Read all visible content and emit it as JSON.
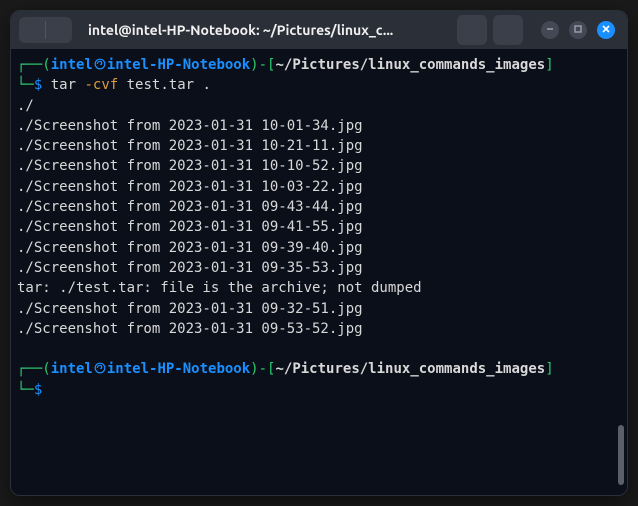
{
  "titlebar": {
    "title": "intel@intel-HP-Notebook: ~/Pictures/linux_c..."
  },
  "prompt": {
    "open_br": "┌──(",
    "user": "intel",
    "at": "㉿",
    "host": "intel-HP-Notebook",
    "close_br": ")-[",
    "path": "~/Pictures/linux_commands_images",
    "end_br": "]",
    "line2_pre": "└─",
    "dollar": "$"
  },
  "command": {
    "bin": "tar",
    "flag": "-cvf",
    "args": "test.tar ."
  },
  "output": [
    "./",
    "./Screenshot from 2023-01-31 10-01-34.jpg",
    "./Screenshot from 2023-01-31 10-21-11.jpg",
    "./Screenshot from 2023-01-31 10-10-52.jpg",
    "./Screenshot from 2023-01-31 10-03-22.jpg",
    "./Screenshot from 2023-01-31 09-43-44.jpg",
    "./Screenshot from 2023-01-31 09-41-55.jpg",
    "./Screenshot from 2023-01-31 09-39-40.jpg",
    "./Screenshot from 2023-01-31 09-35-53.jpg",
    "tar: ./test.tar: file is the archive; not dumped",
    "./Screenshot from 2023-01-31 09-32-51.jpg",
    "./Screenshot from 2023-01-31 09-53-52.jpg"
  ]
}
